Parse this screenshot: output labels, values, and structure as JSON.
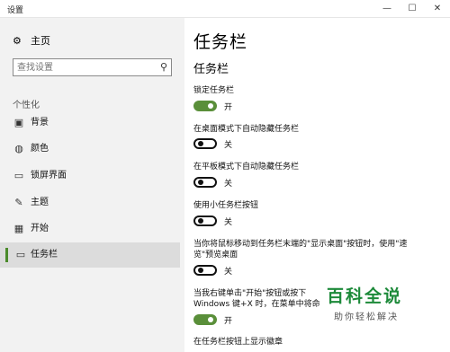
{
  "window": {
    "title": "设置",
    "minimize": "—",
    "maximize": "☐",
    "close": "✕"
  },
  "sidebar": {
    "home_label": "主页",
    "search_placeholder": "查找设置",
    "group_label": "个性化",
    "items": [
      {
        "label": "背景",
        "icon": "image-icon",
        "glyph": "▣"
      },
      {
        "label": "颜色",
        "icon": "palette-icon",
        "glyph": "◍"
      },
      {
        "label": "锁屏界面",
        "icon": "monitor-icon",
        "glyph": "▭"
      },
      {
        "label": "主题",
        "icon": "brush-icon",
        "glyph": "✎"
      },
      {
        "label": "开始",
        "icon": "start-icon",
        "glyph": "▦"
      },
      {
        "label": "任务栏",
        "icon": "taskbar-icon",
        "glyph": "▭",
        "selected": true
      }
    ]
  },
  "main": {
    "page_title": "任务栏",
    "section_title": "任务栏",
    "settings": [
      {
        "label": "锁定任务栏",
        "state": "开",
        "on": true
      },
      {
        "label": "在桌面模式下自动隐藏任务栏",
        "state": "关",
        "on": false
      },
      {
        "label": "在平板模式下自动隐藏任务栏",
        "state": "关",
        "on": false
      },
      {
        "label": "使用小任务栏按钮",
        "state": "关",
        "on": false
      },
      {
        "label": "当你将鼠标移动到任务栏末端的\"显示桌面\"按钮时，使用\"速览\"预览桌面",
        "state": "关",
        "on": false
      },
      {
        "label": "当我右键单击\"开始\"按钮或按下 Windows 键+X 时，在菜单中将命令提示符替换为 Windows PowerShell",
        "state": "开",
        "on": true
      },
      {
        "label": "在任务栏按钮上显示徽章",
        "state": "",
        "on": null
      }
    ]
  },
  "watermark": {
    "main": "百科全说",
    "sub": "助你轻松解决"
  },
  "colors": {
    "accent": "#5a8f3a",
    "sidebar_bg": "#f2f2f2",
    "selected_bg": "#dcdcdc"
  }
}
